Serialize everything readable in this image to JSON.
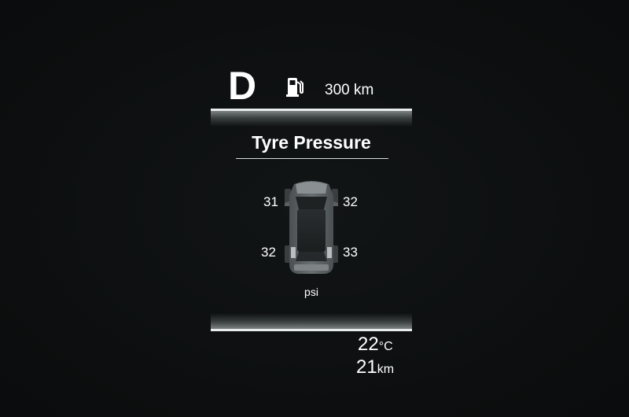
{
  "status": {
    "gear": "D",
    "fuel_icon": "fuel-pump-icon",
    "range": "300 km"
  },
  "panel": {
    "title": "Tyre Pressure",
    "tyres": {
      "front_left": "31",
      "front_right": "32",
      "rear_left": "32",
      "rear_right": "33"
    },
    "unit": "psi",
    "car_icon": "car-top-view-icon"
  },
  "readouts": {
    "temperature_value": "22",
    "temperature_unit": "°C",
    "trip_value": "21",
    "trip_unit": "km"
  },
  "colors": {
    "background": "#0d0f10",
    "text": "#ffffff",
    "divider": "#e9ecec"
  }
}
